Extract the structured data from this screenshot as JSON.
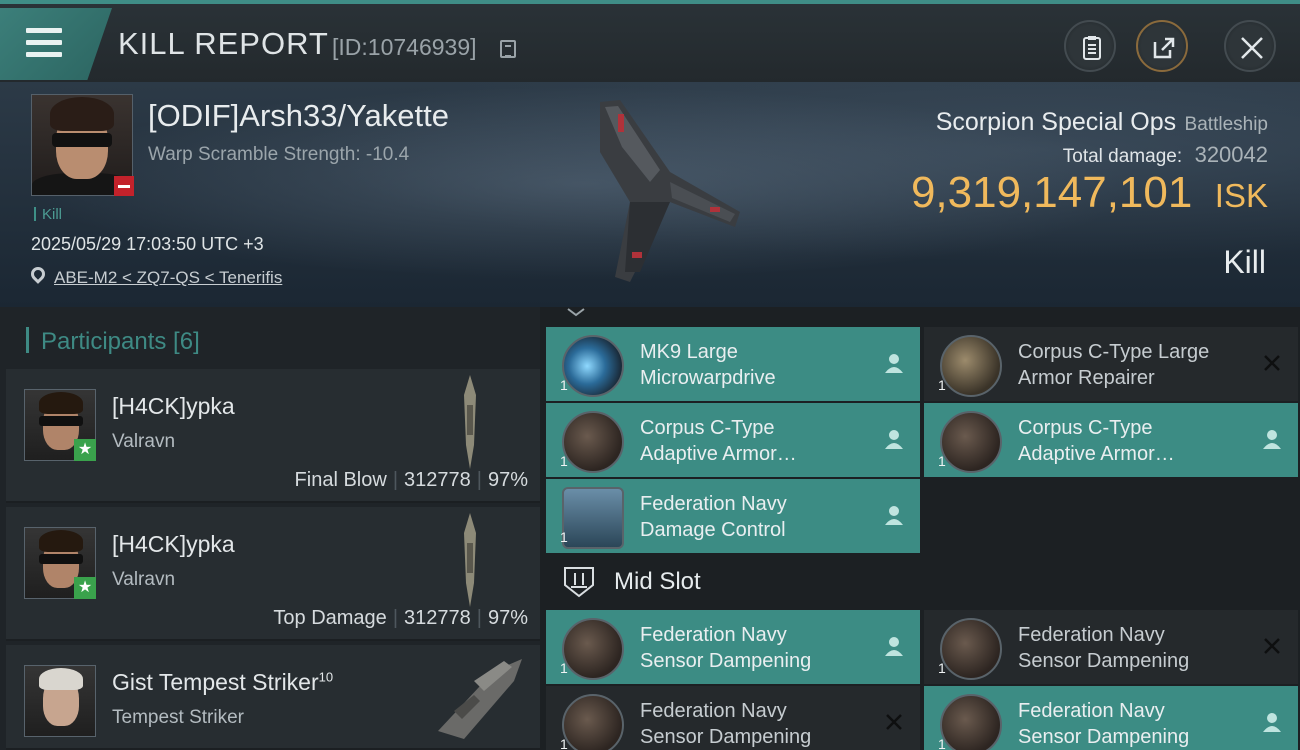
{
  "header": {
    "title": "KILL REPORT",
    "report_id": "[ID:10746939]"
  },
  "victim": {
    "name": "[ODIF]Arsh33/Yakette",
    "warp_scramble": "Warp Scramble Strength: -10.4",
    "tag": "Kill",
    "datetime": "2025/05/29 17:03:50 UTC +3",
    "location": "ABE-M2 < ZQ7-QS < Tenerifis",
    "ship_name": "Scorpion Special Ops",
    "ship_class": "Battleship",
    "total_damage_label": "Total damage:",
    "total_damage": "320042",
    "isk_value": "9,319,147,101",
    "isk_unit": "ISK",
    "result": "Kill"
  },
  "participants": {
    "header": "Participants [6]",
    "items": [
      {
        "name": "[H4CK]ypka",
        "ship": "Valravn",
        "role": "Final Blow",
        "damage": "312778",
        "percent": "97%"
      },
      {
        "name": "[H4CK]ypka",
        "ship": "Valravn",
        "role": "Top Damage",
        "damage": "312778",
        "percent": "97%"
      },
      {
        "name": "Gist Tempest Striker",
        "name_sup": "10",
        "ship": "Tempest Striker"
      }
    ]
  },
  "modules": {
    "mid_slot_label": "Mid Slot",
    "low": [
      {
        "line1": "MK9 Large",
        "line2": "Microwarpdrive",
        "qty": "1",
        "status": "fitted"
      },
      {
        "line1": "Corpus C-Type Large",
        "line2": "Armor Repairer",
        "qty": "1",
        "status": "destroyed"
      },
      {
        "line1": "Corpus C-Type",
        "line2": "Adaptive Armor…",
        "qty": "1",
        "status": "fitted"
      },
      {
        "line1": "Corpus C-Type",
        "line2": "Adaptive Armor…",
        "qty": "1",
        "status": "fitted"
      },
      {
        "line1": "Federation Navy",
        "line2": "Damage Control",
        "qty": "1",
        "status": "fitted"
      }
    ],
    "mid": [
      {
        "line1": "Federation Navy",
        "line2": "Sensor Dampening",
        "qty": "1",
        "status": "fitted"
      },
      {
        "line1": "Federation Navy",
        "line2": "Sensor Dampening",
        "qty": "1",
        "status": "destroyed"
      },
      {
        "line1": "Federation Navy",
        "line2": "Sensor Dampening",
        "qty": "1",
        "status": "destroyed"
      },
      {
        "line1": "Federation Navy",
        "line2": "Sensor Dampening",
        "qty": "1",
        "status": "fitted"
      }
    ]
  },
  "colors": {
    "accent_teal": "#3c8c84",
    "isk_gold": "#f0b95c",
    "destroyed_bg": "#25292c"
  }
}
